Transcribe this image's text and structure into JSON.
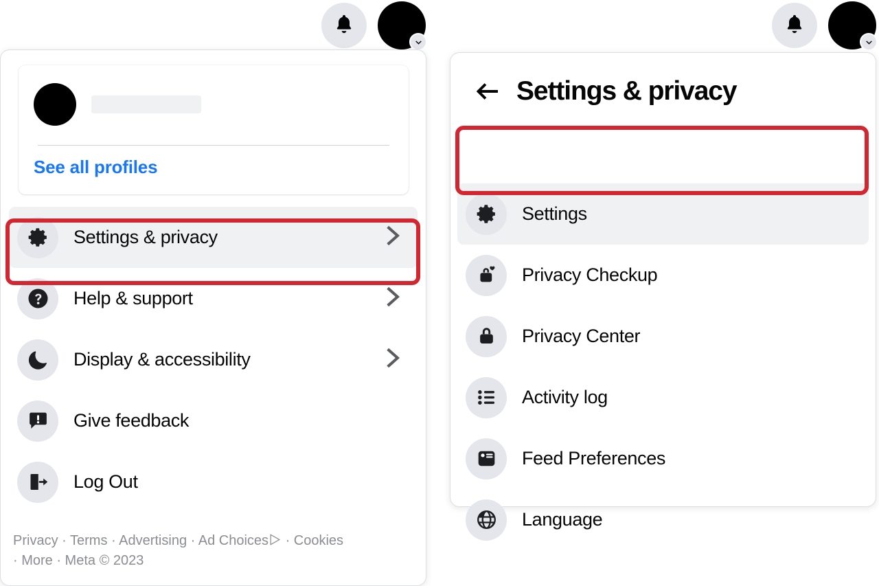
{
  "header": {
    "notifications_icon": "bell-icon",
    "account_icon": "avatar",
    "account_chevron_icon": "chevron-down-icon"
  },
  "left_panel": {
    "profile_card": {
      "avatar_icon": "avatar",
      "name_placeholder": "",
      "see_all_profiles_label": "See all profiles"
    },
    "menu_items": [
      {
        "label": "Settings & privacy",
        "icon": "gear-icon",
        "chevron": "chevron-right-icon",
        "active": true
      },
      {
        "label": "Help & support",
        "icon": "question-mark-circle-icon",
        "chevron": "chevron-right-icon",
        "active": false
      },
      {
        "label": "Display & accessibility",
        "icon": "moon-icon",
        "chevron": "chevron-right-icon",
        "active": false
      },
      {
        "label": "Give feedback",
        "icon": "feedback-bubble-icon",
        "chevron": "",
        "active": false
      },
      {
        "label": "Log Out",
        "icon": "logout-door-icon",
        "chevron": "",
        "active": false
      }
    ],
    "footer": {
      "line1_parts": [
        "Privacy",
        "Terms",
        "Advertising",
        "Ad Choices"
      ],
      "adchoices_icon": "adchoices-icon",
      "line1_tail": "Cookies",
      "line2": "More · Meta © 2023"
    }
  },
  "right_panel": {
    "back_icon": "arrow-left-icon",
    "title": "Settings & privacy",
    "menu_items": [
      {
        "label": "Settings",
        "icon": "gear-icon",
        "active": true
      },
      {
        "label": "Privacy Checkup",
        "icon": "lock-heart-icon",
        "active": false
      },
      {
        "label": "Privacy Center",
        "icon": "lock-icon",
        "active": false
      },
      {
        "label": "Activity log",
        "icon": "list-bullet-icon",
        "active": false
      },
      {
        "label": "Feed Preferences",
        "icon": "feed-card-icon",
        "active": false
      },
      {
        "label": "Language",
        "icon": "globe-icon",
        "active": false
      }
    ]
  },
  "annotations": {
    "highlight_color": "#d22630",
    "left_highlight_target": "Settings & privacy",
    "right_highlight_target": "Settings"
  }
}
